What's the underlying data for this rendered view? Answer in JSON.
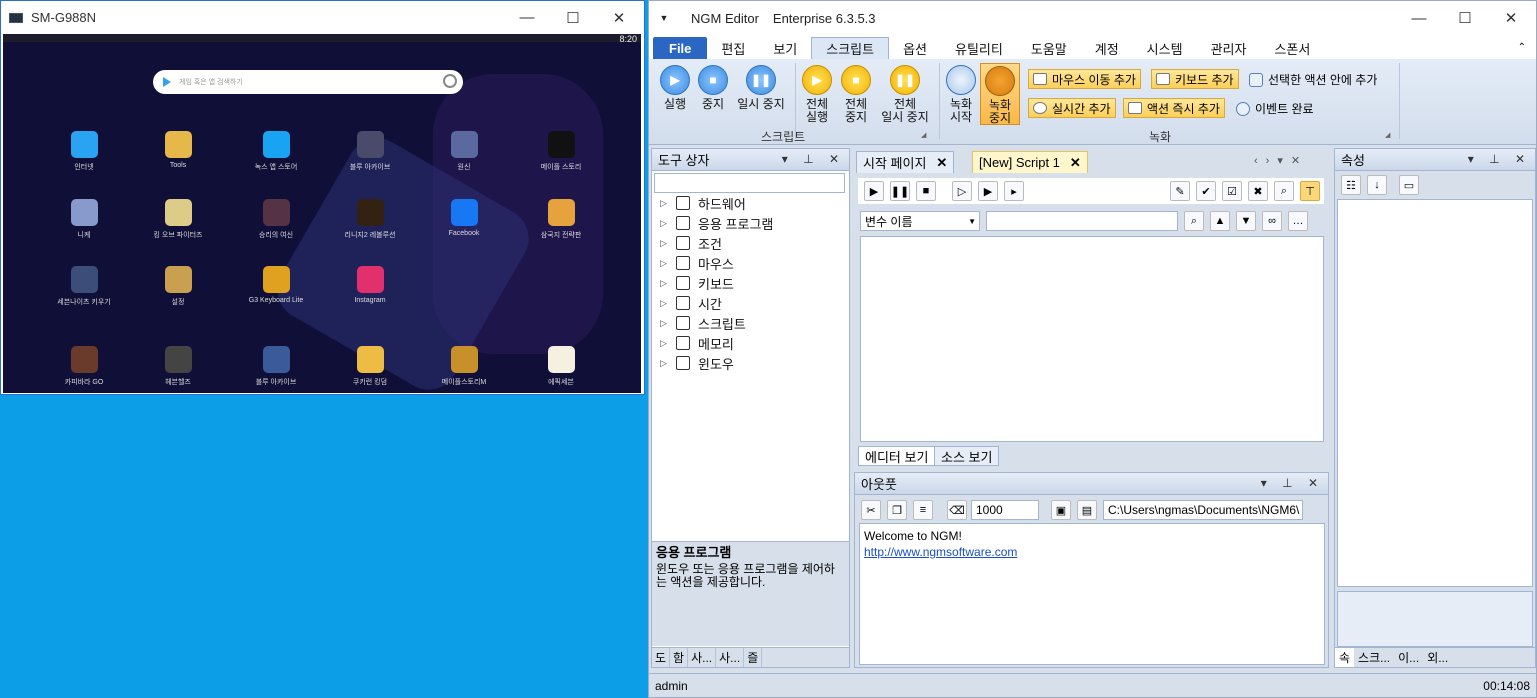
{
  "mirror": {
    "title": "SM-G988N",
    "status_time": "8:20",
    "search_placeholder": "게임 혹은 앱 검색하기",
    "apps": [
      {
        "label": "인터넷",
        "color": "#29a3f2"
      },
      {
        "label": "Tools",
        "color": "#e6b84a"
      },
      {
        "label": "녹스 앱 스토어",
        "color": "#19a4f3"
      },
      {
        "label": "블루 아카이브",
        "color": "#4a4a6a"
      },
      {
        "label": "원신",
        "color": "#5a6aa0"
      },
      {
        "label": "메이플 스토리",
        "color": "#111111"
      },
      {
        "label": "니케",
        "color": "#8899cc"
      },
      {
        "label": "킹 오브 파이터즈",
        "color": "#ddcc88"
      },
      {
        "label": "승리의 여신",
        "color": "#553344"
      },
      {
        "label": "리니지2 레볼루션",
        "color": "#332211"
      },
      {
        "label": "Facebook",
        "color": "#1877f2"
      },
      {
        "label": "삼국지 전략판",
        "color": "#e6a23c"
      },
      {
        "label": "세븐나이츠 키우기",
        "color": "#3d4d7a"
      },
      {
        "label": "설정",
        "color": "#c8a050"
      },
      {
        "label": "G3 Keyboard Lite",
        "color": "#e0a020"
      },
      {
        "label": "Instagram",
        "color": "#e1306c"
      },
      {
        "label": "카피바라 GO",
        "color": "#6a3a2a"
      },
      {
        "label": "헤븐헬즈",
        "color": "#444444"
      },
      {
        "label": "블루 아카이브",
        "color": "#3a5a9a"
      },
      {
        "label": "쿠키런 킹덤",
        "color": "#eebb44"
      },
      {
        "label": "메이플스토리M",
        "color": "#c8902a"
      },
      {
        "label": "에픽세븐",
        "color": "#f5f0e0"
      }
    ]
  },
  "ngm": {
    "app_title": "NGM Editor",
    "edition": "Enterprise 6.3.5.3",
    "menu": [
      "File",
      "편집",
      "보기",
      "스크립트",
      "옵션",
      "유틸리티",
      "도움말",
      "계정",
      "시스템",
      "관리자",
      "스폰서"
    ],
    "ribbon": {
      "play": "실행",
      "stop": "중지",
      "pause": "일시 중지",
      "run_all_1": "전체",
      "run_all_2": "실행",
      "stop_all_1": "전체",
      "stop_all_2": "중지",
      "pause_all_1": "전체",
      "pause_all_2": "일시 중지",
      "group_script": "스크립트",
      "rec_start_1": "녹화",
      "rec_start_2": "시작",
      "rec_stop_1": "녹화",
      "rec_stop_2": "중지",
      "add_mouse_move": "마우스 이동 추가",
      "add_keyboard": "키보드 추가",
      "add_in_selected": "선택한 액션 안에 추가",
      "add_realtime": "실시간 추가",
      "action_add_now": "액션 즉시 추가",
      "event_done": "이벤트 완료",
      "group_record": "녹화"
    },
    "toolbox": {
      "title": "도구 상자",
      "items": [
        "하드웨어",
        "응용 프로그램",
        "조건",
        "마우스",
        "키보드",
        "시간",
        "스크립트",
        "메모리",
        "윈도우"
      ],
      "desc_title": "응용 프로그램",
      "desc_text": "윈도우 또는 응용 프로그램을 제어하는 액션을 제공합니다.",
      "tabs": [
        "도",
        "함",
        "사...",
        "사...",
        "즐"
      ]
    },
    "editor": {
      "tab_start": "시작 페이지",
      "tab_script": "[New] Script 1",
      "var_select": "변수 이름",
      "sub_editor": "에디터 보기",
      "sub_source": "소스 보기"
    },
    "output": {
      "title": "아웃풋",
      "count": "1000",
      "path": "C:\\Users\\ngmas\\Documents\\NGM6\\",
      "line1": "Welcome to NGM!",
      "link": "http://www.ngmsoftware.com"
    },
    "props": {
      "title": "속성",
      "tabs": [
        "속",
        "스크...",
        "이...",
        "외..."
      ]
    },
    "status": {
      "user": "admin",
      "timer": "00:14:08"
    }
  }
}
